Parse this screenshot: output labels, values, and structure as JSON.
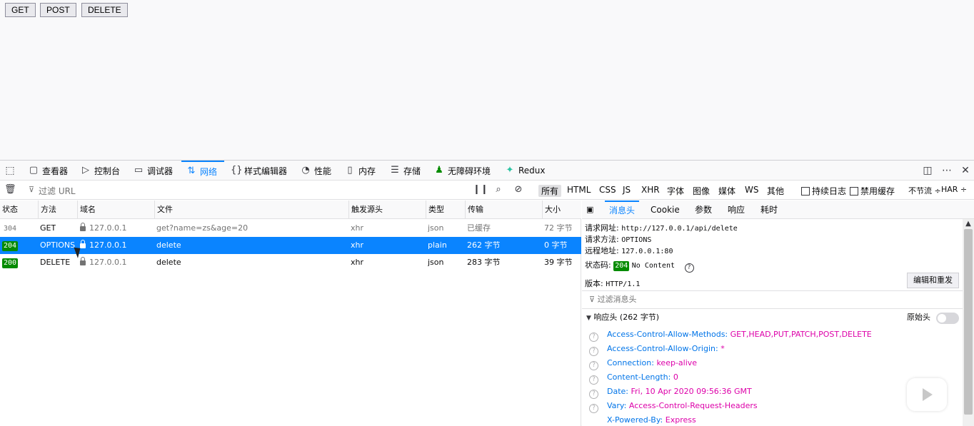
{
  "page": {
    "buttons": [
      "GET",
      "POST",
      "DELETE"
    ]
  },
  "toolbar": {
    "tabs": [
      {
        "label": "查看器",
        "icon": "inspector-icon"
      },
      {
        "label": "控制台",
        "icon": "console-icon"
      },
      {
        "label": "调试器",
        "icon": "debugger-icon"
      },
      {
        "label": "网络",
        "icon": "network-icon",
        "active": true
      },
      {
        "label": "样式编辑器",
        "icon": "style-editor-icon"
      },
      {
        "label": "性能",
        "icon": "performance-icon"
      },
      {
        "label": "内存",
        "icon": "memory-icon"
      },
      {
        "label": "存储",
        "icon": "storage-icon"
      },
      {
        "label": "无障碍环境",
        "icon": "accessibility-icon"
      },
      {
        "label": "Redux",
        "icon": "redux-icon"
      }
    ]
  },
  "filterbar": {
    "url_placeholder": "过滤 URL",
    "types": [
      "所有",
      "HTML",
      "CSS",
      "JS",
      "XHR",
      "字体",
      "图像",
      "媒体",
      "WS",
      "其他"
    ],
    "persist_log": "持续日志",
    "disable_cache": "禁用缓存",
    "throttle": "不节流 ÷",
    "har": "HAR ÷"
  },
  "columns": [
    "状态",
    "方法",
    "域名",
    "文件",
    "触发源头",
    "类型",
    "传输",
    "大小"
  ],
  "requests": [
    {
      "status": "304",
      "method": "GET",
      "domain": "127.0.0.1",
      "file": "get?name=zs&age=20",
      "cause": "xhr",
      "type": "json",
      "transferred": "已缓存",
      "size": "72 字节"
    },
    {
      "status": "204",
      "method": "OPTIONS",
      "domain": "127.0.0.1",
      "file": "delete",
      "cause": "xhr",
      "type": "plain",
      "transferred": "262 字节",
      "size": "0 字节"
    },
    {
      "status": "200",
      "method": "DELETE",
      "domain": "127.0.0.1",
      "file": "delete",
      "cause": "xhr",
      "type": "json",
      "transferred": "283 字节",
      "size": "39 字节"
    }
  ],
  "detail": {
    "tabs": [
      "消息头",
      "Cookie",
      "参数",
      "响应",
      "耗时"
    ],
    "request_url_label": "请求网址:",
    "request_url": "http://127.0.0.1/api/delete",
    "request_method_label": "请求方法:",
    "request_method": "OPTIONS",
    "remote_addr_label": "远程地址:",
    "remote_addr": "127.0.0.1:80",
    "status_label": "状态码:",
    "status_code": "204",
    "status_text": "No Content",
    "version_label": "版本:",
    "version": "HTTP/1.1",
    "resend_button": "编辑和重发",
    "filter_headers_placeholder": "过滤消息头",
    "response_headers_label": "响应头 (262 字节)",
    "raw_headers_label": "原始头",
    "headers": [
      {
        "name": "Access-Control-Allow-Methods:",
        "value": "GET,HEAD,PUT,PATCH,POST,DELETE"
      },
      {
        "name": "Access-Control-Allow-Origin:",
        "value": "*"
      },
      {
        "name": "Connection:",
        "value": "keep-alive"
      },
      {
        "name": "Content-Length:",
        "value": "0"
      },
      {
        "name": "Date:",
        "value": "Fri, 10 Apr 2020 09:56:36 GMT"
      },
      {
        "name": "Vary:",
        "value": "Access-Control-Request-Headers"
      },
      {
        "name": "X-Powered-By:",
        "value": "Express"
      }
    ]
  }
}
